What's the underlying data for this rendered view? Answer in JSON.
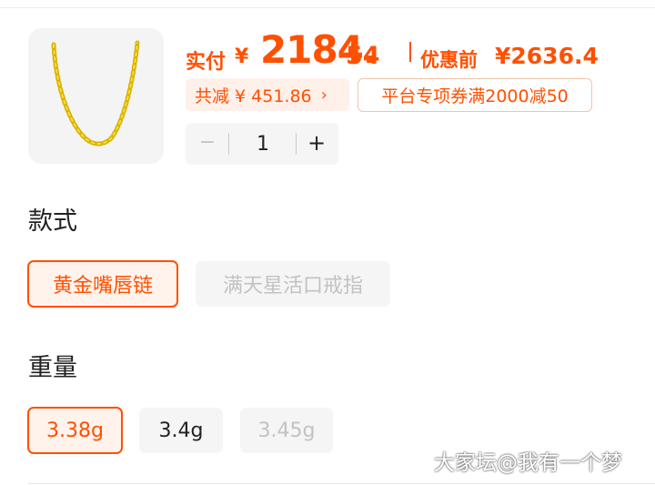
{
  "product": {
    "image_icon": "gold-necklace-image"
  },
  "price": {
    "pay_label": "实付",
    "pay_currency": "¥",
    "pay_integer": "2184.",
    "pay_decimal": "54",
    "original_label": "优惠前",
    "original_value": "¥2636.4",
    "discount_text": "共减 ¥ 451.86",
    "discount_chevron": "›",
    "coupon_text": "平台专项券满2000减50",
    "accent_color": "#ff5000"
  },
  "quantity": {
    "minus_label": "−",
    "value": "1",
    "plus_label": "+"
  },
  "style_section": {
    "title": "款式",
    "options": [
      {
        "label": "黄金嘴唇链",
        "state": "selected"
      },
      {
        "label": "满天星活口戒指",
        "state": "disabled"
      }
    ]
  },
  "weight_section": {
    "title": "重量",
    "options": [
      {
        "label": "3.38g",
        "state": "selected"
      },
      {
        "label": "3.4g",
        "state": "normal"
      },
      {
        "label": "3.45g",
        "state": "disabled"
      }
    ]
  },
  "watermark": "大家坛@我有一个梦"
}
